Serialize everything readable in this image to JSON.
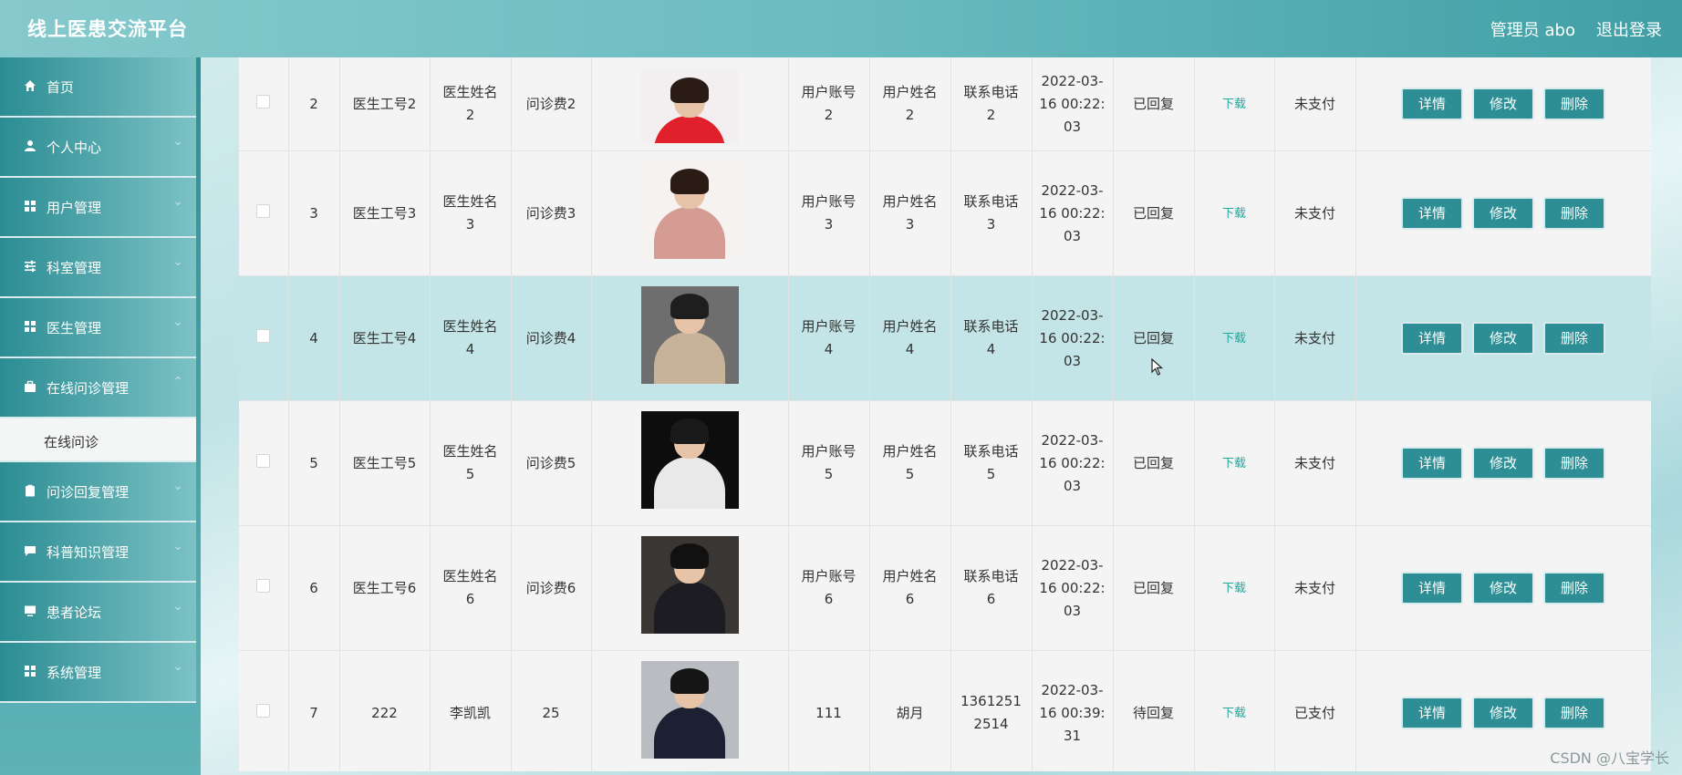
{
  "header": {
    "brand": "线上医患交流平台",
    "user": "管理员 abo",
    "logout": "退出登录"
  },
  "sidebar": {
    "items": [
      {
        "label": "首页",
        "icon": "home-icon",
        "chev": ""
      },
      {
        "label": "个人中心",
        "icon": "user-icon",
        "chev": "⌄"
      },
      {
        "label": "用户管理",
        "icon": "grid-icon",
        "chev": "⌄"
      },
      {
        "label": "科室管理",
        "icon": "sliders-icon",
        "chev": "⌄"
      },
      {
        "label": "医生管理",
        "icon": "grid-icon",
        "chev": "⌄"
      },
      {
        "label": "在线问诊管理",
        "icon": "briefcase-icon",
        "chev": "⌃"
      }
    ],
    "submenu": {
      "label": "在线问诊"
    },
    "items2": [
      {
        "label": "问诊回复管理",
        "icon": "clipboard-icon",
        "chev": "⌄"
      },
      {
        "label": "科普知识管理",
        "icon": "chat-icon",
        "chev": "⌄"
      },
      {
        "label": "患者论坛",
        "icon": "monitor-icon",
        "chev": "⌄"
      },
      {
        "label": "系统管理",
        "icon": "grid-icon",
        "chev": "⌄"
      }
    ]
  },
  "table": {
    "rows": [
      {
        "idx": "2",
        "docno": "医生工号2",
        "docname_a": "医生姓名",
        "docname_b": "2",
        "fee": "问诊费2",
        "acct_a": "用户账号",
        "acct_b": "2",
        "uname_a": "用户姓名",
        "uname_b": "2",
        "phone_a": "联系电话",
        "phone_b": "2",
        "time_a": "2022-03-",
        "time_b": "16 00:22:",
        "time_c": "03",
        "status": "已回复",
        "download": "下载",
        "pay": "未支付"
      },
      {
        "idx": "3",
        "docno": "医生工号3",
        "docname_a": "医生姓名",
        "docname_b": "3",
        "fee": "问诊费3",
        "acct_a": "用户账号",
        "acct_b": "3",
        "uname_a": "用户姓名",
        "uname_b": "3",
        "phone_a": "联系电话",
        "phone_b": "3",
        "time_a": "2022-03-",
        "time_b": "16 00:22:",
        "time_c": "03",
        "status": "已回复",
        "download": "下载",
        "pay": "未支付"
      },
      {
        "idx": "4",
        "docno": "医生工号4",
        "docname_a": "医生姓名",
        "docname_b": "4",
        "fee": "问诊费4",
        "acct_a": "用户账号",
        "acct_b": "4",
        "uname_a": "用户姓名",
        "uname_b": "4",
        "phone_a": "联系电话",
        "phone_b": "4",
        "time_a": "2022-03-",
        "time_b": "16 00:22:",
        "time_c": "03",
        "status": "已回复",
        "download": "下载",
        "pay": "未支付"
      },
      {
        "idx": "5",
        "docno": "医生工号5",
        "docname_a": "医生姓名",
        "docname_b": "5",
        "fee": "问诊费5",
        "acct_a": "用户账号",
        "acct_b": "5",
        "uname_a": "用户姓名",
        "uname_b": "5",
        "phone_a": "联系电话",
        "phone_b": "5",
        "time_a": "2022-03-",
        "time_b": "16 00:22:",
        "time_c": "03",
        "status": "已回复",
        "download": "下载",
        "pay": "未支付"
      },
      {
        "idx": "6",
        "docno": "医生工号6",
        "docname_a": "医生姓名",
        "docname_b": "6",
        "fee": "问诊费6",
        "acct_a": "用户账号",
        "acct_b": "6",
        "uname_a": "用户姓名",
        "uname_b": "6",
        "phone_a": "联系电话",
        "phone_b": "6",
        "time_a": "2022-03-",
        "time_b": "16 00:22:",
        "time_c": "03",
        "status": "已回复",
        "download": "下载",
        "pay": "未支付"
      },
      {
        "idx": "7",
        "docno": "222",
        "docname_a": "李凯凯",
        "docname_b": "",
        "fee": "25",
        "acct_a": "111",
        "acct_b": "",
        "uname_a": "胡月",
        "uname_b": "",
        "phone_a": "1361251",
        "phone_b": "2514",
        "time_a": "2022-03-",
        "time_b": "16 00:39:",
        "time_c": "31",
        "status": "待回复",
        "download": "下载",
        "pay": "已支付"
      }
    ],
    "buttons": {
      "detail": "详情",
      "edit": "修改",
      "delete": "删除"
    }
  },
  "watermark": "CSDN @八宝学长"
}
